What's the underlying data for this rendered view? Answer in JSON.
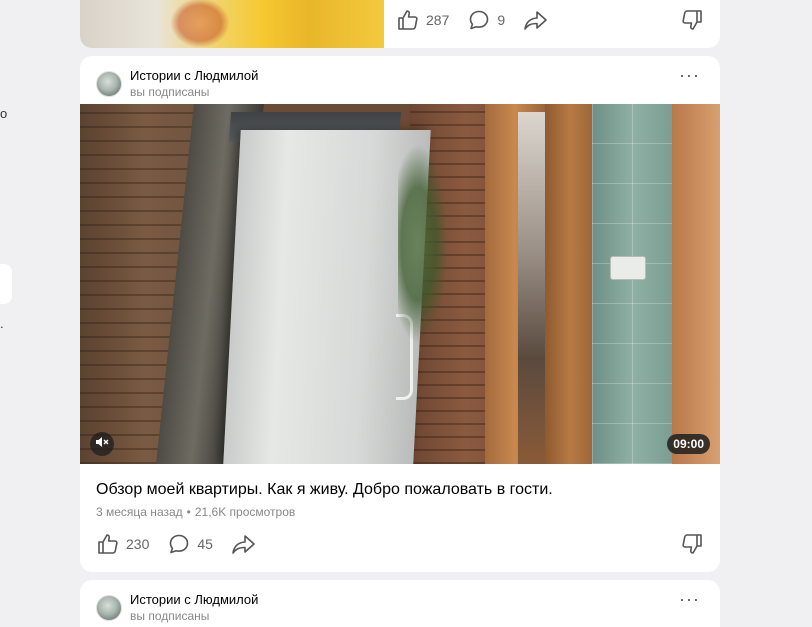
{
  "sidebar": {
    "fragments": [
      "о",
      "."
    ]
  },
  "previous_post": {
    "likes": "287",
    "comments": "9"
  },
  "post": {
    "author": {
      "name": "Истории с Людмилой",
      "status": "вы подписаны"
    },
    "more_label": "···",
    "video": {
      "duration": "09:00",
      "muted": true
    },
    "title": "Обзор моей квартиры. Как я живу. Добро пожаловать в гости.",
    "meta": {
      "published": "3 месяца назад",
      "separator": "•",
      "views": "21,6K просмотров"
    },
    "likes": "230",
    "comments": "45"
  },
  "next_post": {
    "author": {
      "name": "Истории с Людмилой",
      "status": "вы подписаны"
    },
    "more_label": "···"
  },
  "colors": {
    "background": "#f0f0f2",
    "card": "#ffffff",
    "secondary_text": "#888888",
    "icon": "#555555"
  },
  "icons": [
    "like-icon",
    "comment-icon",
    "share-icon",
    "dislike-icon",
    "mute-icon",
    "more-icon"
  ]
}
